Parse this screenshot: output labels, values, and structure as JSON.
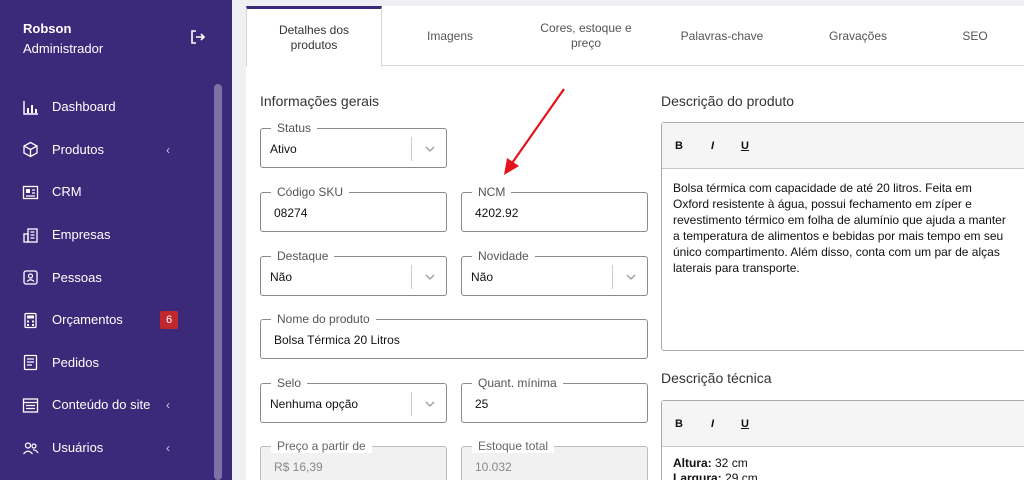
{
  "user": {
    "name": "Robson",
    "role": "Administrador"
  },
  "nav": [
    {
      "label": "Dashboard",
      "icon": "chart-bar-icon"
    },
    {
      "label": "Produtos",
      "icon": "box-icon",
      "chevron": "‹"
    },
    {
      "label": "CRM",
      "icon": "crm-icon"
    },
    {
      "label": "Empresas",
      "icon": "building-icon"
    },
    {
      "label": "Pessoas",
      "icon": "person-card-icon"
    },
    {
      "label": "Orçamentos",
      "icon": "calculator-icon",
      "badge": "6"
    },
    {
      "label": "Pedidos",
      "icon": "document-icon"
    },
    {
      "label": "Conteúdo do site",
      "icon": "layout-icon",
      "chevron": "‹"
    },
    {
      "label": "Usuários",
      "icon": "users-icon",
      "chevron": "‹"
    }
  ],
  "tabs": [
    "Detalhes dos produtos",
    "Imagens",
    "Cores, estoque e preço",
    "Palavras-chave",
    "Gravações",
    "SEO"
  ],
  "general": {
    "title": "Informações gerais",
    "status": {
      "label": "Status",
      "value": "Ativo"
    },
    "sku": {
      "label": "Código SKU",
      "value": "08274"
    },
    "ncm": {
      "label": "NCM",
      "value": "4202.92"
    },
    "destaque": {
      "label": "Destaque",
      "value": "Não"
    },
    "novidade": {
      "label": "Novidade",
      "value": "Não"
    },
    "nome": {
      "label": "Nome do produto",
      "value": "Bolsa Térmica 20 Litros"
    },
    "selo": {
      "label": "Selo",
      "value": "Nenhuma opção"
    },
    "quant": {
      "label": "Quant. mínima",
      "value": "25"
    },
    "preco": {
      "label": "Preço a partir de",
      "value": "R$ 16,39"
    },
    "estoque": {
      "label": "Estoque total",
      "value": "10.032"
    }
  },
  "descricao": {
    "title": "Descrição do produto",
    "bold": "B",
    "italic": "I",
    "underline": "U",
    "text": "Bolsa térmica com capacidade de até 20 litros. Feita em\nOxford resistente à água, possui fechamento em zíper e\nrevestimento térmico em folha de alumínio que ajuda a manter\na temperatura de alimentos e bebidas por mais tempo em seu\núnico compartimento. Além disso, conta com um par de alças\nlaterais para transporte."
  },
  "tecnica": {
    "title": "Descrição técnica",
    "bold": "B",
    "italic": "I",
    "underline": "U",
    "lines": [
      {
        "label": "Altura:",
        "value": " 32 cm"
      },
      {
        "label": "Largura:",
        "value": " 29 cm"
      }
    ]
  },
  "colors": {
    "sidebar": "#3b2a7a",
    "badge": "#c0282e",
    "arrow": "#e3141b"
  }
}
